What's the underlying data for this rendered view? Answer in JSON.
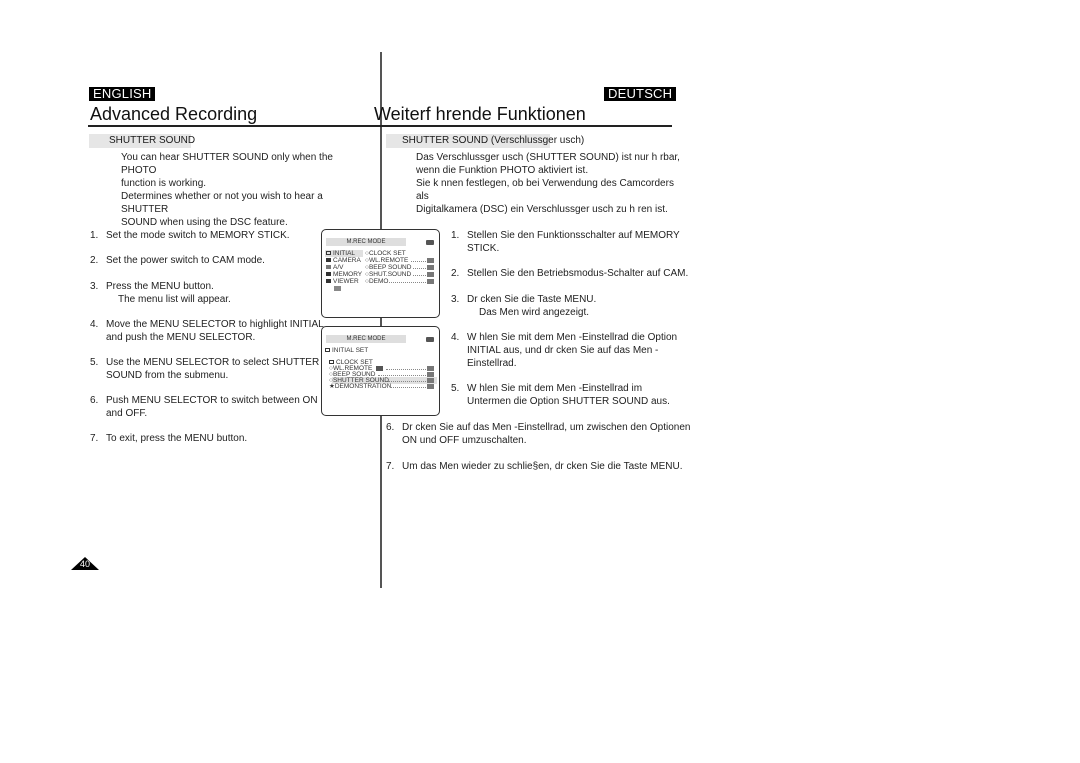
{
  "header": {
    "lang_left": "ENGLISH",
    "lang_right": "DEUTSCH",
    "title_left": "Advanced Recording",
    "title_right": "Weiterf hrende Funktionen"
  },
  "english": {
    "section_title": "SHUTTER SOUND",
    "intro": [
      "You can hear SHUTTER SOUND only when the PHOTO",
      "function is working.",
      "Determines whether or not you wish to hear a SHUTTER",
      "SOUND when using the DSC feature."
    ],
    "steps": [
      {
        "num": "1.",
        "lines": [
          "Set the mode switch to MEMORY STICK."
        ]
      },
      {
        "num": "2.",
        "lines": [
          "Set the power switch to CAM mode."
        ]
      },
      {
        "num": "3.",
        "lines": [
          "Press the MENU button."
        ],
        "sub": "The menu list will appear."
      },
      {
        "num": "4.",
        "lines": [
          "Move the MENU SELECTOR to highlight INITIAL",
          "and push the MENU SELECTOR."
        ]
      },
      {
        "num": "5.",
        "lines": [
          "Use the MENU SELECTOR to select SHUTTER",
          "SOUND from the submenu."
        ]
      },
      {
        "num": "6.",
        "lines": [
          "Push MENU SELECTOR to switch between ON",
          "and OFF."
        ]
      },
      {
        "num": "7.",
        "lines": [
          "To exit, press the MENU button."
        ]
      }
    ]
  },
  "deutsch": {
    "section_title": "SHUTTER SOUND (Verschlussger usch)",
    "intro": [
      "Das Verschlussger  usch (SHUTTER SOUND) ist nur h  rbar,",
      "wenn die Funktion PHOTO aktiviert ist.",
      "Sie k  nnen festlegen, ob bei Verwendung des Camcorders als",
      "Digitalkamera (DSC) ein Verschlussger  usch zu h  ren ist."
    ],
    "steps": [
      {
        "num": "1.",
        "lines": [
          "Stellen Sie den Funktionsschalter auf MEMORY",
          "STICK."
        ]
      },
      {
        "num": "2.",
        "lines": [
          "Stellen Sie den Betriebsmodus-Schalter auf CAM."
        ]
      },
      {
        "num": "3.",
        "lines": [
          "Dr  cken Sie die Taste MENU."
        ],
        "sub": "Das Men   wird angezeigt."
      },
      {
        "num": "4.",
        "lines": [
          "W  hlen Sie mit dem Men  -Einstellrad die Option",
          "INITIAL aus, und dr  cken Sie auf das Men  -",
          "Einstellrad."
        ]
      },
      {
        "num": "5.",
        "lines": [
          "W  hlen Sie mit dem Men  -Einstellrad im",
          "Untermen   die Option SHUTTER SOUND aus."
        ]
      },
      {
        "num": "6.",
        "lines": [
          "Dr  cken Sie auf das Men  -Einstellrad, um zwischen den Optionen",
          "ON und OFF umzuschalten."
        ]
      },
      {
        "num": "7.",
        "lines": [
          "Um das Men   wieder zu schlie§en, dr  cken Sie die Taste MENU."
        ]
      }
    ]
  },
  "screen1": {
    "mode": "M.REC  MODE",
    "left_menu": [
      "INITIAL",
      "CAMERA",
      "A/V",
      "MEMORY",
      "VIEWER"
    ],
    "right_menu": [
      "CLOCK  SET",
      "WL.REMOTE",
      "BEEP SOUND",
      "SHUT.SOUND",
      "DEMO"
    ]
  },
  "screen2": {
    "mode": "M.REC  MODE",
    "submenu_title": "INITIAL SET",
    "items": [
      "CLOCK  SET",
      "WL.REMOTE",
      "BEEP SOUND",
      "SHUTTER SOUND",
      "DEMONSTRATION"
    ],
    "highlighted": "SHUTTER SOUND"
  },
  "page_number": "40"
}
